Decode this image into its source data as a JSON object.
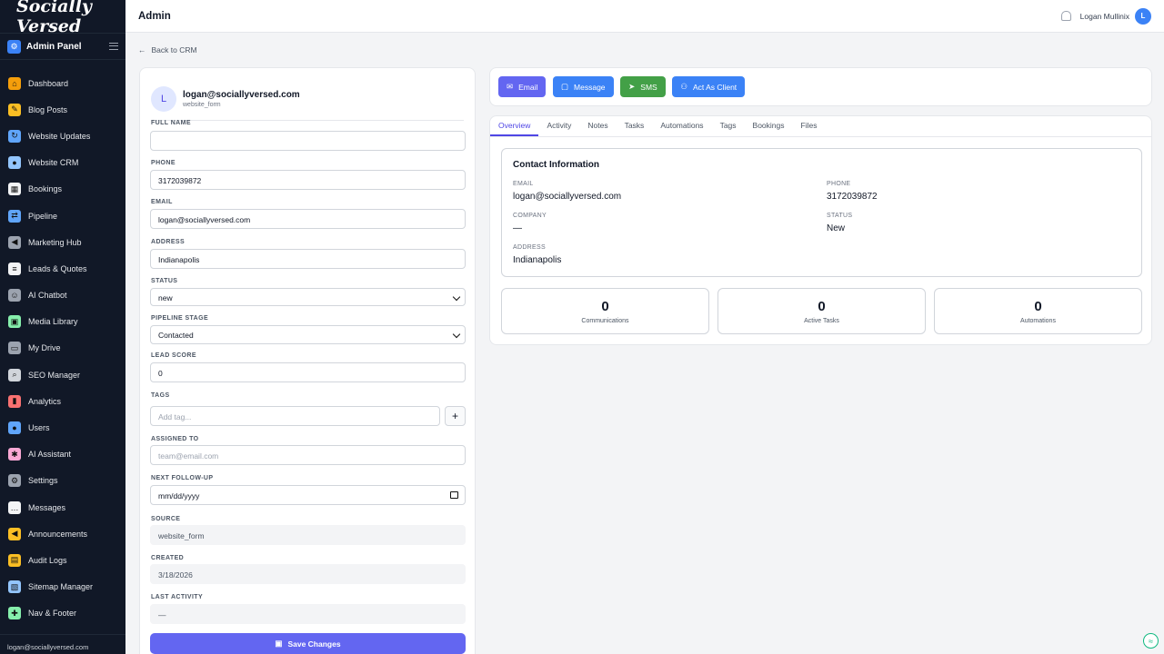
{
  "brand": "Socially Versed",
  "sidebar": {
    "panel_title": "Admin Panel",
    "items": [
      {
        "label": "Dashboard",
        "icon": "🏠",
        "color": "#f59e0b"
      },
      {
        "label": "Blog Posts",
        "icon": "✍",
        "color": "#fbbf24"
      },
      {
        "label": "Website Updates",
        "icon": "🔄",
        "color": "#60a5fa"
      },
      {
        "label": "Website CRM",
        "icon": "👥",
        "color": "#93c5fd"
      },
      {
        "label": "Bookings",
        "icon": "📅",
        "color": "#f3f4f6"
      },
      {
        "label": "Pipeline",
        "icon": "🔀",
        "color": "#60a5fa"
      },
      {
        "label": "Marketing Hub",
        "icon": "📢",
        "color": "#9ca3af"
      },
      {
        "label": "Leads & Quotes",
        "icon": "📋",
        "color": "#f3f4f6"
      },
      {
        "label": "AI Chatbot",
        "icon": "🤖",
        "color": "#9ca3af"
      },
      {
        "label": "Media Library",
        "icon": "🖼",
        "color": "#86efac"
      },
      {
        "label": "My Drive",
        "icon": "📁",
        "color": "#9ca3af"
      },
      {
        "label": "SEO Manager",
        "icon": "🔍",
        "color": "#d1d5db"
      },
      {
        "label": "Analytics",
        "icon": "📊",
        "color": "#f87171"
      },
      {
        "label": "Users",
        "icon": "👤",
        "color": "#60a5fa"
      },
      {
        "label": "AI Assistant",
        "icon": "🧠",
        "color": "#f9a8d4"
      },
      {
        "label": "Settings",
        "icon": "⚙",
        "color": "#9ca3af"
      },
      {
        "label": "Messages",
        "icon": "💬",
        "color": "#f3f4f6"
      },
      {
        "label": "Announcements",
        "icon": "📣",
        "color": "#fbbf24"
      },
      {
        "label": "Audit Logs",
        "icon": "🗂",
        "color": "#fbbf24"
      },
      {
        "label": "Sitemap Manager",
        "icon": "🗺",
        "color": "#93c5fd"
      },
      {
        "label": "Nav & Footer",
        "icon": "🧩",
        "color": "#86efac"
      }
    ],
    "footer_email": "logan@sociallyversed.com"
  },
  "topbar": {
    "title": "Admin",
    "user_name": "Logan Mullinix",
    "avatar_letter": "L"
  },
  "back_link": "Back to CRM",
  "contact": {
    "avatar_letter": "L",
    "email": "logan@sociallyversed.com",
    "source": "website_form"
  },
  "form": {
    "full_name_label": "FULL NAME",
    "full_name_value": "",
    "phone_label": "PHONE",
    "phone_value": "3172039872",
    "email_label": "EMAIL",
    "email_value": "logan@sociallyversed.com",
    "address_label": "ADDRESS",
    "address_value": "Indianapolis",
    "status_label": "STATUS",
    "status_value": "new",
    "pipeline_label": "PIPELINE STAGE",
    "pipeline_value": "Contacted",
    "lead_score_label": "LEAD SCORE",
    "lead_score_value": "0",
    "tags_label": "TAGS",
    "tags_placeholder": "Add tag...",
    "assigned_label": "ASSIGNED TO",
    "assigned_placeholder": "team@email.com",
    "followup_label": "NEXT FOLLOW-UP",
    "followup_value": "mm/dd/yyyy",
    "source_label": "SOURCE",
    "source_value": "website_form",
    "created_label": "CREATED",
    "created_value": "3/18/2026",
    "last_activity_label": "LAST ACTIVITY",
    "last_activity_value": "—",
    "save_label": "Save Changes"
  },
  "actions": {
    "email": {
      "label": "Email",
      "color": "#6366f1"
    },
    "message": {
      "label": "Message",
      "color": "#3b82f6"
    },
    "sms": {
      "label": "SMS",
      "color": "#4ade80"
    },
    "act_as_client": {
      "label": "Act As Client",
      "color": "#3b82f6"
    }
  },
  "tabs": [
    "Overview",
    "Activity",
    "Notes",
    "Tasks",
    "Automations",
    "Tags",
    "Bookings",
    "Files"
  ],
  "overview": {
    "title": "Contact Information",
    "email_label": "EMAIL",
    "email_value": "logan@sociallyversed.com",
    "phone_label": "PHONE",
    "phone_value": "3172039872",
    "company_label": "COMPANY",
    "company_value": "—",
    "status_label": "STATUS",
    "status_value": "New",
    "address_label": "ADDRESS",
    "address_value": "Indianapolis"
  },
  "stats": [
    {
      "value": "0",
      "label": "Communications"
    },
    {
      "value": "0",
      "label": "Active Tasks"
    },
    {
      "value": "0",
      "label": "Automations"
    }
  ]
}
